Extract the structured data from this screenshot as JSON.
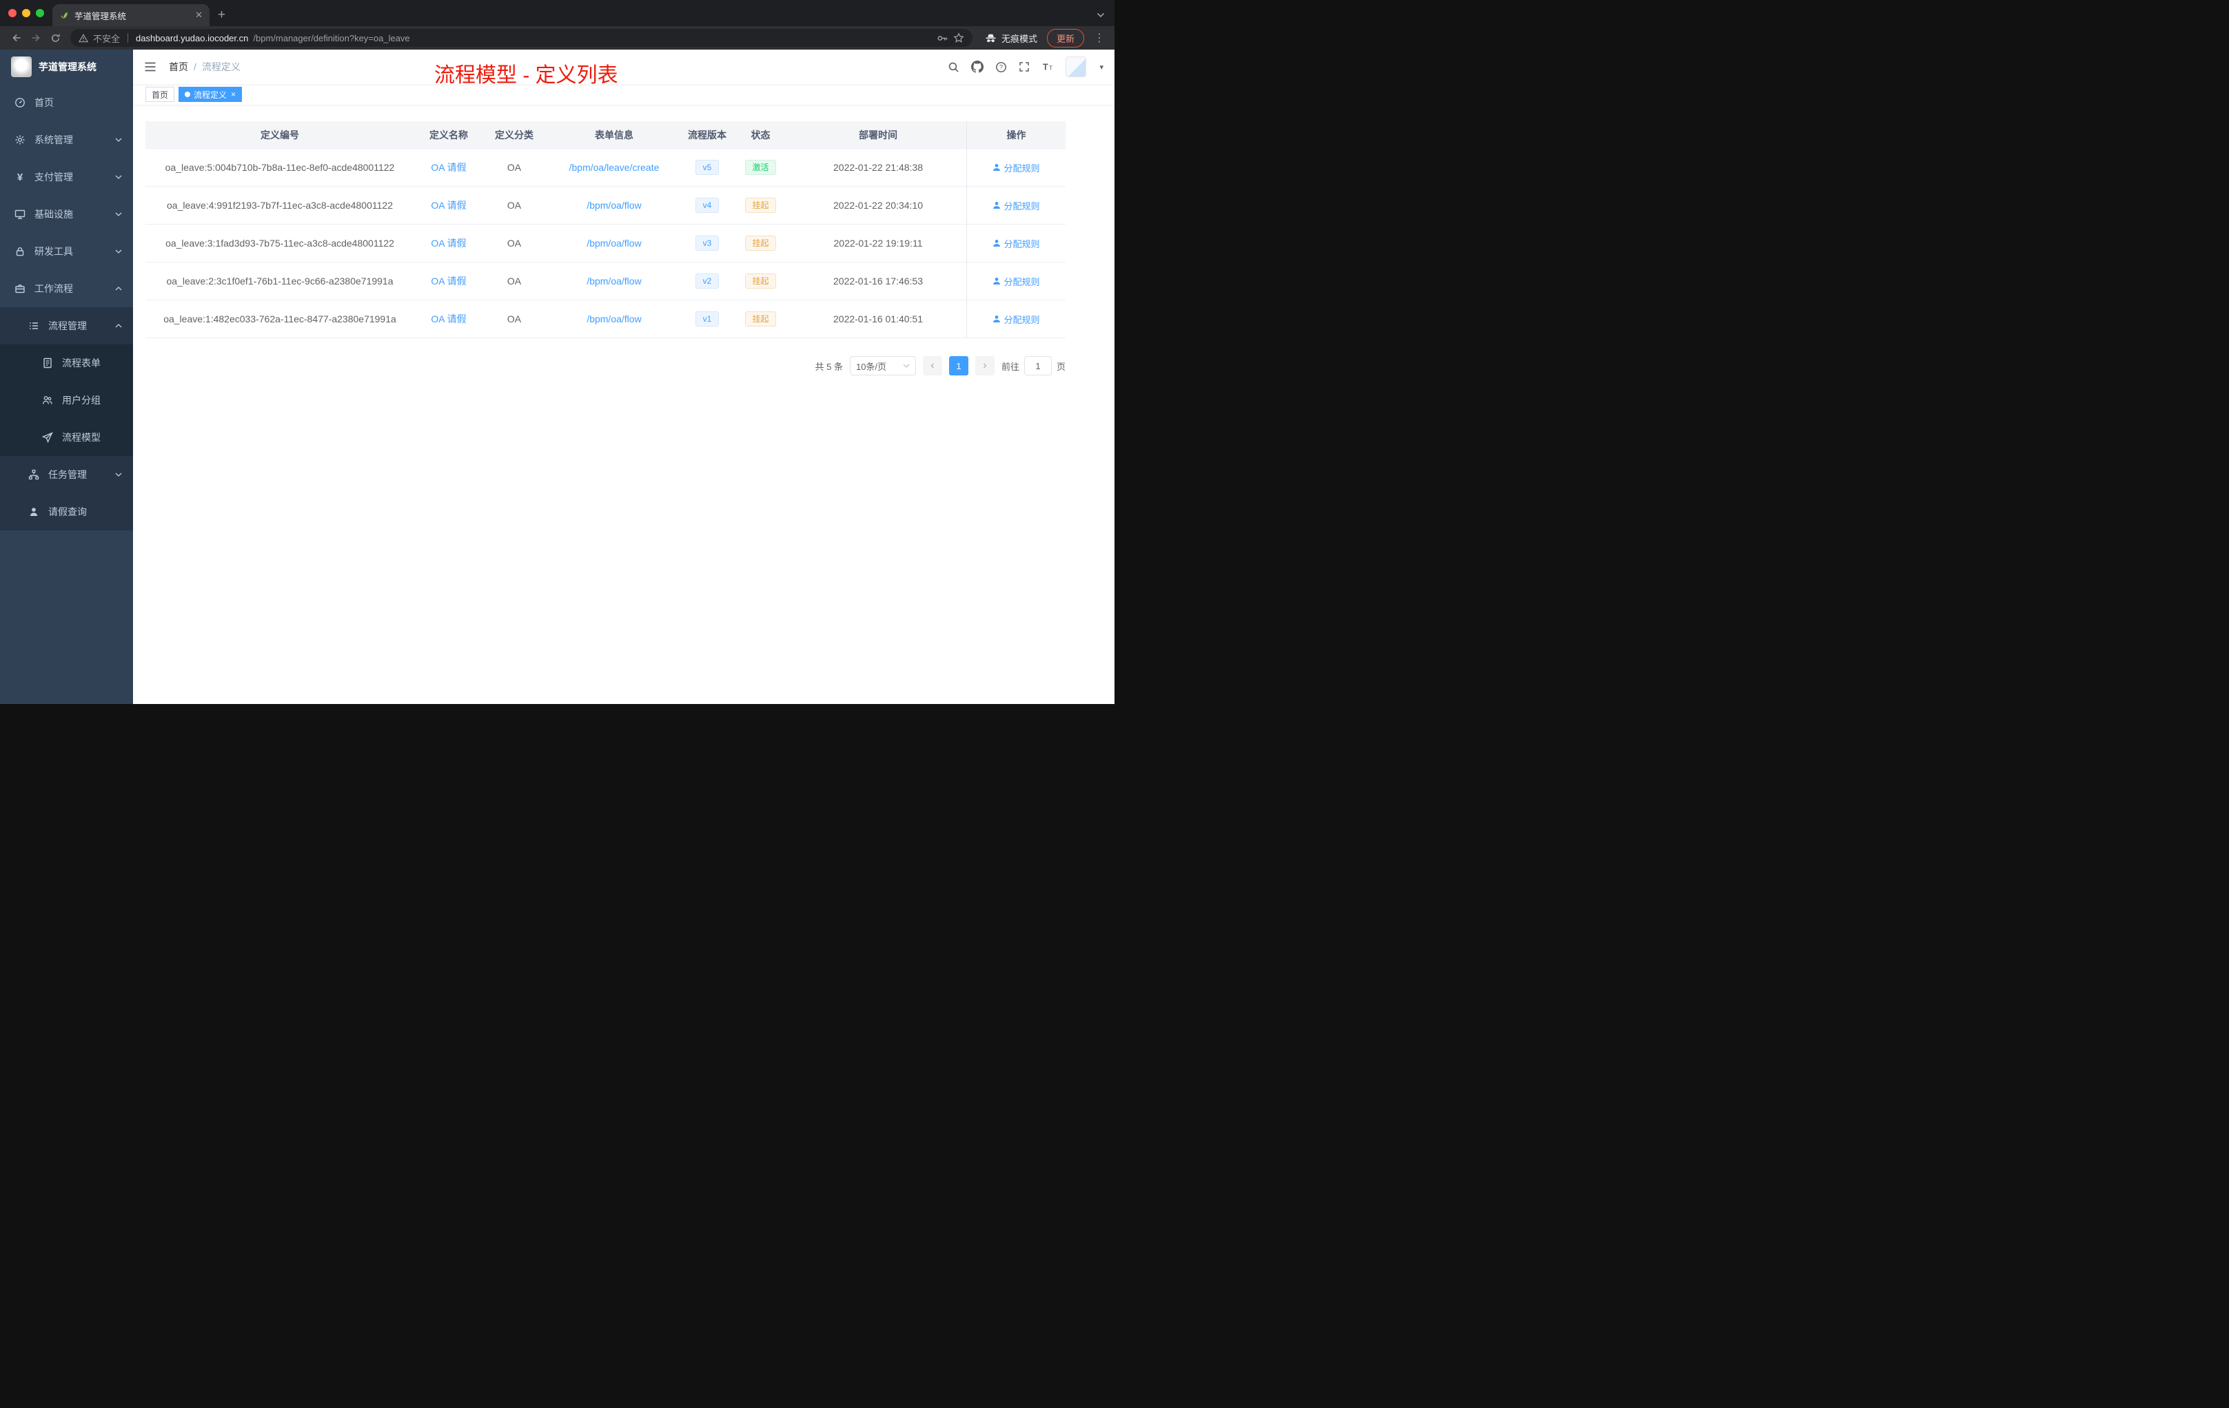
{
  "colors": {
    "accent": "#409eff",
    "success": "#13ce66",
    "warning": "#e6a23c",
    "annotation_red": "#ed1b0c",
    "sidebar_bg": "#304156",
    "traffic_lights": [
      "#ff5f57",
      "#febc2e",
      "#28c840"
    ]
  },
  "glyphs": {
    "tab_close": "✕",
    "new_tab": "+",
    "kebab": "⋮",
    "caret_down": "▾",
    "yen": "¥",
    "tag_close": "×"
  },
  "browser": {
    "tab_title": "芋道管理系统",
    "security_label": "不安全",
    "url_host": "dashboard.yudao.iocoder.cn",
    "url_path": "/bpm/manager/definition?key=oa_leave",
    "incognito_label": "无痕模式",
    "update_label": "更新"
  },
  "sidebar": {
    "logo_title": "芋道管理系统",
    "items": [
      {
        "label": "首页"
      },
      {
        "label": "系统管理"
      },
      {
        "label": "支付管理"
      },
      {
        "label": "基础设施"
      },
      {
        "label": "研发工具"
      },
      {
        "label": "工作流程"
      },
      {
        "label": "流程管理"
      },
      {
        "label": "流程表单"
      },
      {
        "label": "用户分组"
      },
      {
        "label": "流程模型"
      },
      {
        "label": "任务管理"
      },
      {
        "label": "请假查询"
      }
    ]
  },
  "header": {
    "breadcrumb_home": "首页",
    "breadcrumb_separator": "/",
    "breadcrumb_current": "流程定义",
    "annotation": "流程模型 - 定义列表"
  },
  "tags": {
    "home": "首页",
    "active": "流程定义"
  },
  "table": {
    "columns": {
      "id": "定义编号",
      "name": "定义名称",
      "category": "定义分类",
      "form": "表单信息",
      "version": "流程版本",
      "status": "状态",
      "deploy_time": "部署时间",
      "actions": "操作"
    },
    "rows": [
      {
        "id": "oa_leave:5:004b710b-7b8a-11ec-8ef0-acde48001122",
        "name": "OA 请假",
        "category": "OA",
        "form": "/bpm/oa/leave/create",
        "version": "v5",
        "status": "激活",
        "status_type": "success",
        "deploy_time": "2022-01-22 21:48:38",
        "action": "分配规则"
      },
      {
        "id": "oa_leave:4:991f2193-7b7f-11ec-a3c8-acde48001122",
        "name": "OA 请假",
        "category": "OA",
        "form": "/bpm/oa/flow",
        "version": "v4",
        "status": "挂起",
        "status_type": "warning",
        "deploy_time": "2022-01-22 20:34:10",
        "action": "分配规则"
      },
      {
        "id": "oa_leave:3:1fad3d93-7b75-11ec-a3c8-acde48001122",
        "name": "OA 请假",
        "category": "OA",
        "form": "/bpm/oa/flow",
        "version": "v3",
        "status": "挂起",
        "status_type": "warning",
        "deploy_time": "2022-01-22 19:19:11",
        "action": "分配规则"
      },
      {
        "id": "oa_leave:2:3c1f0ef1-76b1-11ec-9c66-a2380e71991a",
        "name": "OA 请假",
        "category": "OA",
        "form": "/bpm/oa/flow",
        "version": "v2",
        "status": "挂起",
        "status_type": "warning",
        "deploy_time": "2022-01-16 17:46:53",
        "action": "分配规则"
      },
      {
        "id": "oa_leave:1:482ec033-762a-11ec-8477-a2380e71991a",
        "name": "OA 请假",
        "category": "OA",
        "form": "/bpm/oa/flow",
        "version": "v1",
        "status": "挂起",
        "status_type": "warning",
        "deploy_time": "2022-01-16 01:40:51",
        "action": "分配规则"
      }
    ]
  },
  "pagination": {
    "total": "共 5 条",
    "page_size": "10条/页",
    "prev": "‹",
    "current_page": "1",
    "next": "›",
    "goto_prefix": "前往",
    "goto_value": "1",
    "goto_suffix": "页"
  }
}
